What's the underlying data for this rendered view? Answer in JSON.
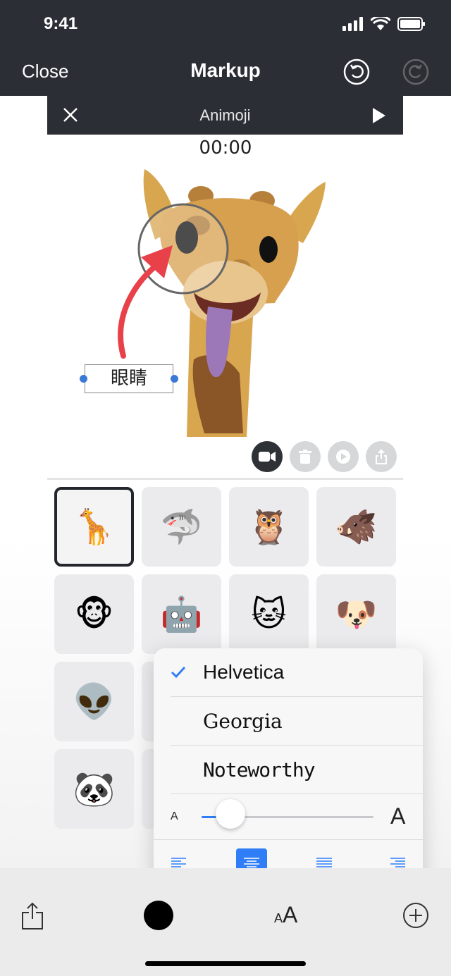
{
  "status": {
    "time": "9:41"
  },
  "nav": {
    "close_label": "Close",
    "title": "Markup"
  },
  "animoji_bar": {
    "title": "Animoji"
  },
  "timer": "00:00",
  "annotation": {
    "text": "眼睛"
  },
  "animoji_grid": [
    {
      "name": "giraffe",
      "emoji": "🦒",
      "selected": true
    },
    {
      "name": "shark",
      "emoji": "🦈"
    },
    {
      "name": "owl",
      "emoji": "🦉"
    },
    {
      "name": "boar",
      "emoji": "🐗"
    },
    {
      "name": "monkey",
      "emoji": "🐵"
    },
    {
      "name": "robot",
      "emoji": "🤖"
    },
    {
      "name": "cat",
      "emoji": "🐱"
    },
    {
      "name": "dog",
      "emoji": "🐶"
    },
    {
      "name": "alien",
      "emoji": "👽"
    },
    {
      "name": "panda",
      "emoji": "🐼"
    }
  ],
  "font_popover": {
    "fonts": [
      {
        "label": "Helvetica",
        "selected": true
      },
      {
        "label": "Georgia",
        "selected": false
      },
      {
        "label": "Noteworthy",
        "selected": false
      }
    ],
    "size_small_label": "A",
    "size_large_label": "A",
    "size_value_fraction": 0.17,
    "alignment_options": [
      "left",
      "center",
      "justify",
      "right"
    ],
    "alignment_selected": "center"
  },
  "toolbar": {
    "aa_small": "A",
    "aa_large": "A"
  },
  "colors": {
    "accent": "#2f7ef7",
    "annotation_red": "#e8414a",
    "bar_dark": "#2b2e35"
  }
}
